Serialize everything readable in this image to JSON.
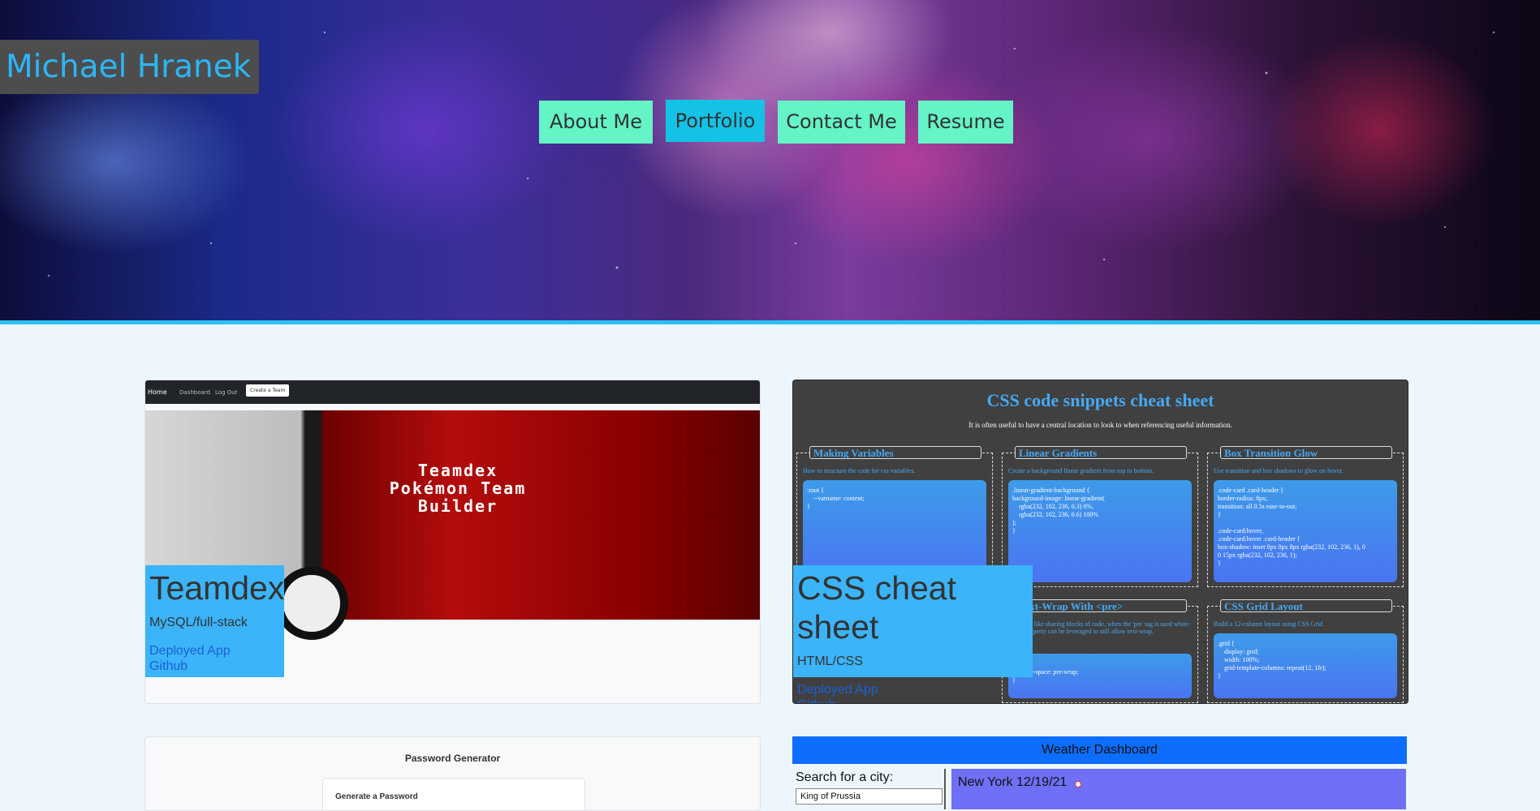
{
  "header": {
    "site_title": "Michael Hranek",
    "nav": [
      {
        "label": "About Me",
        "active": false
      },
      {
        "label": "Portfolio",
        "active": true
      },
      {
        "label": "Contact Me",
        "active": false
      },
      {
        "label": "Resume",
        "active": false
      }
    ]
  },
  "projects": [
    {
      "title": "Teamdex",
      "tech": "MySQL/full-stack",
      "deployed_label": "Deployed App",
      "github_label": "Github",
      "screenshot": {
        "nav": [
          "Home",
          "Dashboard",
          "Log Out",
          "Create a Team"
        ],
        "banner_text": [
          "Teamdex",
          "Pokémon Team",
          "Builder"
        ]
      }
    },
    {
      "title": "CSS cheat sheet",
      "tech": "HTML/CSS",
      "deployed_label": "Deployed App",
      "github_label": "Github",
      "screenshot": {
        "title": "CSS code snippets cheat sheet",
        "subtitle": "It is often useful to have a central location to look to when referencing useful information.",
        "snippets": [
          {
            "header": "Making Variables",
            "desc": "How to structure the code for css variables.",
            "code": ":root {\n    --varname: content;\n}"
          },
          {
            "header": "Linear Gradients",
            "desc": "Create a background linear gradient from top to bottom.",
            "code": ".linear-gradient-background {\nbackground-image: linear-gradient(\n    rgba(232, 102, 236, 0.3) 0%,\n    rgba(232, 102, 236, 0.6) 100%\n);\n}"
          },
          {
            "header": "Box Transition Glow",
            "desc": "Use transition and box shadows to glow on hover.",
            "code": ".code-card .card-header {\nborder-radius: 8px;\ntransition: all 0.5s ease-in-out;\n}\n\n.code-card:hover,\n.code-card:hover .card-header {\nbox-shadow: inset 0px 0px 8px rgba(232, 102, 236, 1), 0\n0 15px rgba(232, 102, 236, 1);\n}"
          },
          {
            "header": "Text-Wrap With <pre>",
            "desc": "Pre tag is like sharing blocks of code, when the 'pre' tag is used white-space property can be leveraged to still allow text-wrap.",
            "code": "pre {\n    white-space: pre-wrap;\n}"
          },
          {
            "header": "CSS Grid Layout",
            "desc": "Build a 12-column layout using CSS Grid",
            "code": ".grid {\n    display: grid;\n    width: 100%;\n    grid-template-columns: repeat(12, 1fr);\n}"
          }
        ]
      }
    },
    {
      "screenshot": {
        "title": "Password Generator",
        "box_label": "Generate a Password"
      }
    },
    {
      "screenshot": {
        "header": "Weather Dashboard",
        "search_label": "Search for a city:",
        "search_value": "King of Prussia",
        "today_label": "New York 12/19/21"
      }
    }
  ]
}
